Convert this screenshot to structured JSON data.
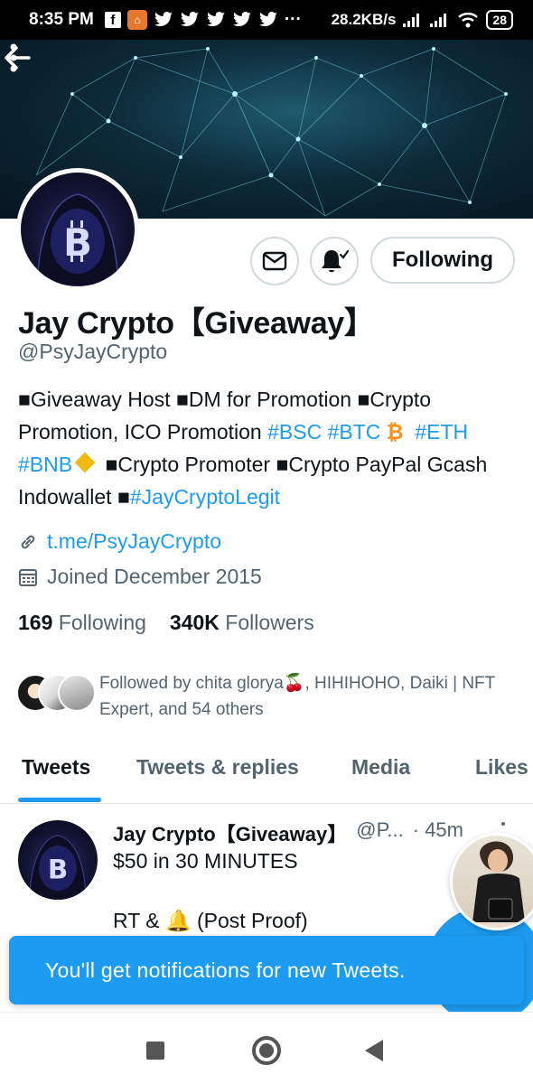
{
  "status_bar": {
    "time": "8:35 PM",
    "network_speed": "28.2KB/s",
    "battery": "28",
    "icons": [
      "facebook-icon",
      "app-notification-icon",
      "twitter-icon",
      "twitter-icon",
      "twitter-icon",
      "twitter-icon",
      "twitter-icon",
      "more-notifications-icon",
      "signal-icon",
      "signal-icon",
      "wifi-icon",
      "battery-icon"
    ]
  },
  "header": {
    "back_icon": "arrow-left-icon",
    "more_icon": "more-vertical-icon"
  },
  "profile": {
    "avatar_letter": "B",
    "name": "Jay Crypto【Giveaway】",
    "handle": "@PsyJayCrypto",
    "bio": {
      "part1": "■Giveaway Host ■DM for Promotion ■Crypto Promotion, ICO Promotion ",
      "tag_bsc": "#BSC",
      "tag_btc": "#BTC",
      "btc_symbol": "₿",
      "tag_eth": "#ETH",
      "tag_bnb": "#BNB",
      "part2": " ■Crypto Promoter ■Crypto PayPal Gcash Indowallet ■",
      "tag_legit": "#JayCryptoLegit"
    },
    "link": "t.me/PsyJayCrypto",
    "joined": "Joined December 2015",
    "following_count": "169",
    "following_label": "Following",
    "followers_count": "340K",
    "followers_label": "Followers",
    "followed_by": "Followed by chita glorya🍒, HIHIHOHO, Daiki | NFT Expert, and 54 others"
  },
  "actions": {
    "message_icon": "mail-icon",
    "notify_icon": "bell-check-icon",
    "following_label": "Following"
  },
  "tabs": [
    {
      "label": "Tweets",
      "active": true
    },
    {
      "label": "Tweets & replies",
      "active": false
    },
    {
      "label": "Media",
      "active": false
    },
    {
      "label": "Likes",
      "active": false
    }
  ],
  "tweet": {
    "name": "Jay Crypto【Giveaway】",
    "handle": "@P...",
    "time": "· 45m",
    "line1": "$50 in 30 MINUTES",
    "line2": "RT & 🔔 (Post Proof)"
  },
  "toast": {
    "message": "You'll get notifications for new Tweets."
  },
  "colors": {
    "accent": "#1d9bf0",
    "text": "#0f1419",
    "muted": "#536471"
  }
}
